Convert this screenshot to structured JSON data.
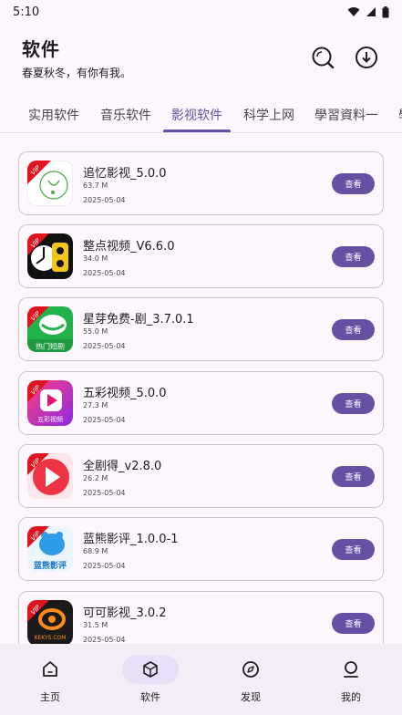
{
  "status": {
    "time": "5:10"
  },
  "header": {
    "title": "软件",
    "subtitle": "春夏秋冬，有你有我。"
  },
  "tabs": [
    {
      "label": "实用软件",
      "active": false
    },
    {
      "label": "音乐软件",
      "active": false
    },
    {
      "label": "影视软件",
      "active": true
    },
    {
      "label": "科学上网",
      "active": false
    },
    {
      "label": "學習資料一",
      "active": false
    },
    {
      "label": "學",
      "active": false
    }
  ],
  "apps": [
    {
      "name": "追忆影视_5.0.0",
      "size": "63.7 M",
      "date": "2025-05-04",
      "button": "查看",
      "icon": "zhuiyi-app-icon"
    },
    {
      "name": "整点视频_V6.6.0",
      "size": "34.0 M",
      "date": "2025-05-04",
      "button": "查看",
      "icon": "zhengdian-app-icon"
    },
    {
      "name": "星芽免费-剧_3.7.0.1",
      "size": "55.0 M",
      "date": "2025-05-04",
      "button": "查看",
      "icon": "xingya-app-icon",
      "icon_text": "热门短剧"
    },
    {
      "name": "五彩视频_5.0.0",
      "size": "27.3 M",
      "date": "2025-05-04",
      "button": "查看",
      "icon": "wucai-app-icon",
      "icon_text": "五彩视频"
    },
    {
      "name": "全剧得_v2.8.0",
      "size": "26.2 M",
      "date": "2025-05-04",
      "button": "查看",
      "icon": "quanjude-app-icon"
    },
    {
      "name": "蓝熊影评_1.0.0-1",
      "size": "68.9 M",
      "date": "2025-05-04",
      "button": "查看",
      "icon": "lanxiong-app-icon",
      "icon_text": "蓝熊影评"
    },
    {
      "name": "可可影视_3.0.2",
      "size": "31.5 M",
      "date": "2025-05-04",
      "button": "查看",
      "icon": "keke-app-icon",
      "icon_text": "KEKYS.COM"
    }
  ],
  "icon_badge": "VIP",
  "nav": [
    {
      "label": "主页",
      "icon": "home-icon",
      "active": false
    },
    {
      "label": "软件",
      "icon": "cube-icon",
      "active": true
    },
    {
      "label": "发现",
      "icon": "compass-icon",
      "active": false
    },
    {
      "label": "我的",
      "icon": "person-icon",
      "active": false
    }
  ],
  "colors": {
    "accent": "#6750a4",
    "background": "#fdf7fd",
    "nav_background": "#f3edf7",
    "nav_active": "#e8def8"
  }
}
